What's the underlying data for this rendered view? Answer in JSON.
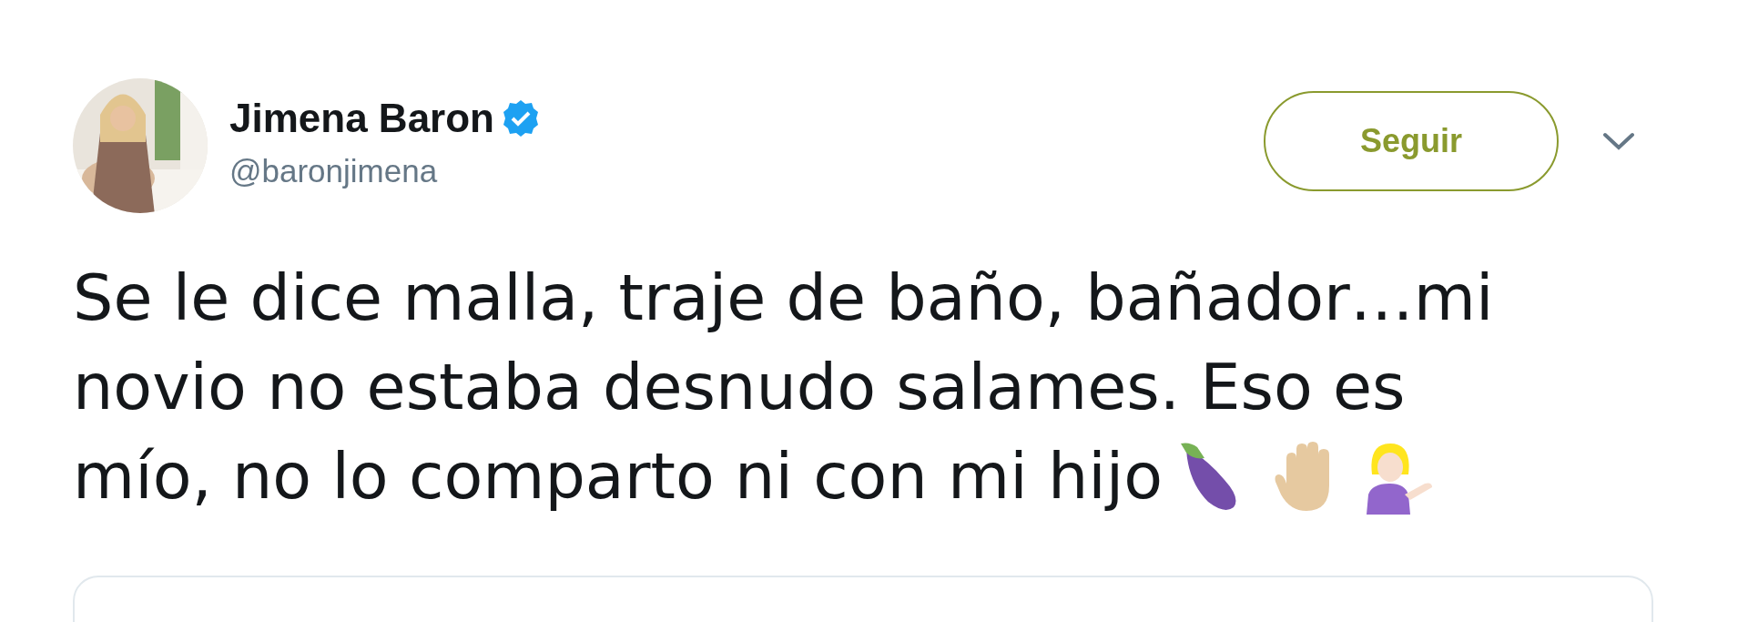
{
  "author": {
    "name": "Jimena Baron",
    "verified": true,
    "handle": "@baronjimena"
  },
  "follow_button": {
    "label": "Seguir"
  },
  "tweet": {
    "text_lines": [
      "Se le dice malla, traje de baño, bañador…mi",
      "novio no estaba desnudo salames. Eso es",
      "mío, no lo comparto ni con mi hijo"
    ],
    "emojis": [
      {
        "kind": "eggplant"
      },
      {
        "kind": "hand"
      },
      {
        "kind": "woman"
      }
    ]
  }
}
